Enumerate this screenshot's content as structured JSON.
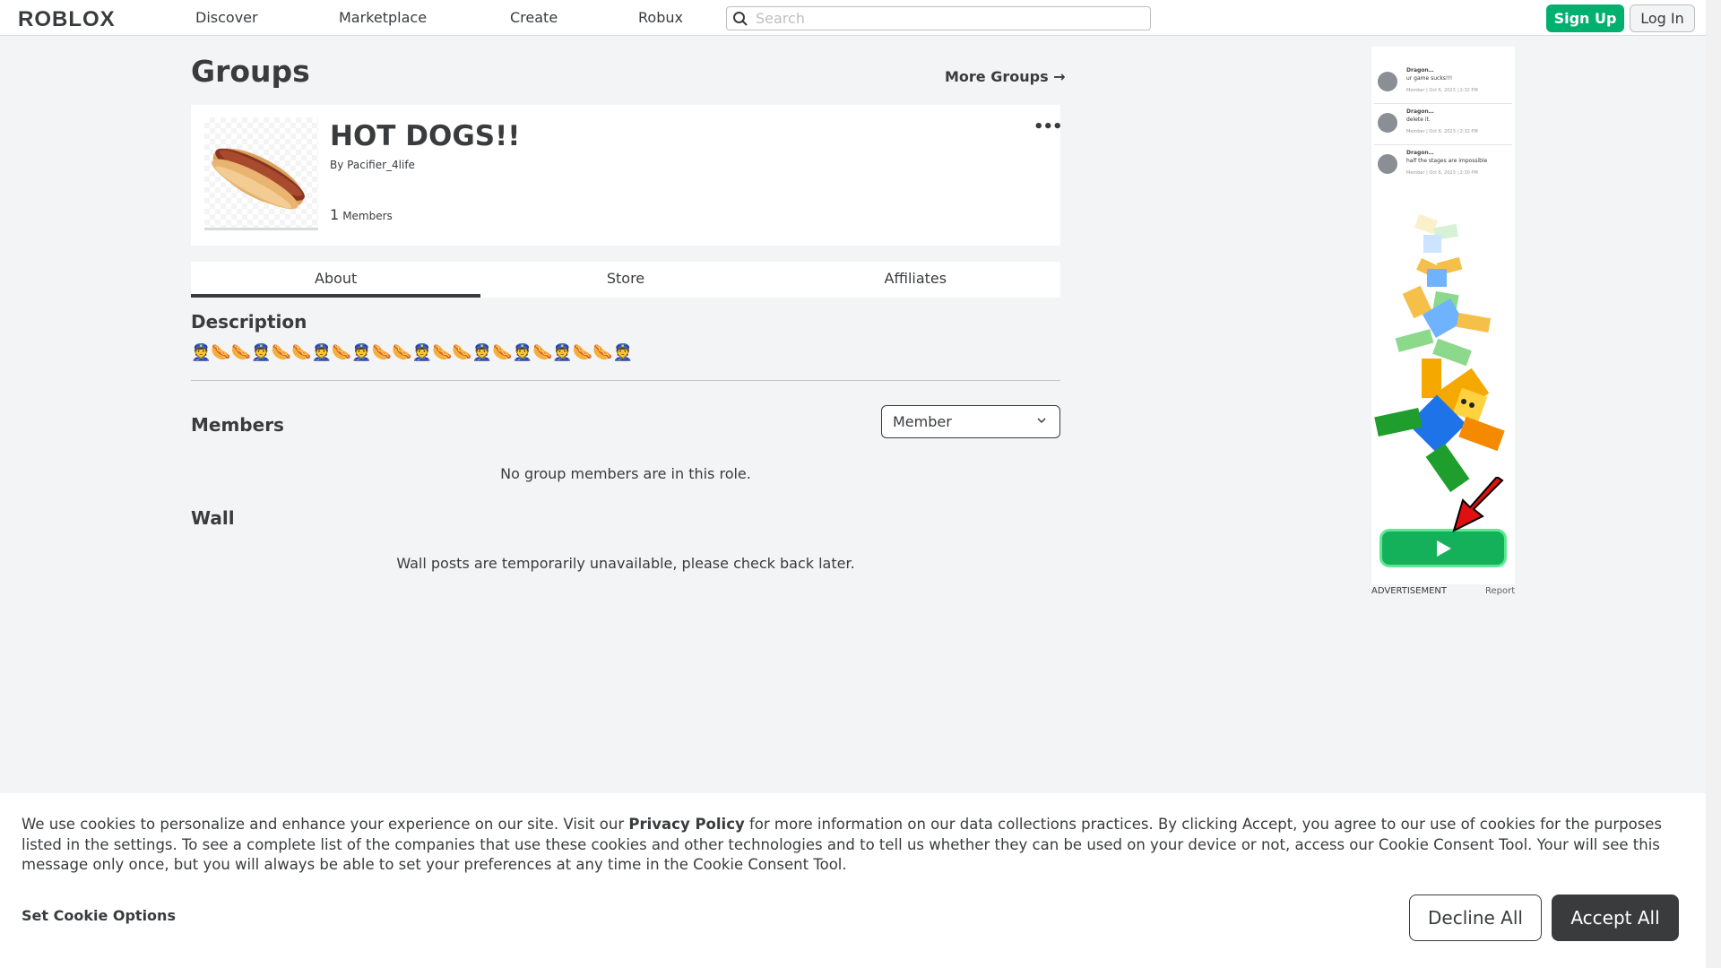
{
  "nav": {
    "logo": "ROBLOX",
    "items": [
      "Discover",
      "Marketplace",
      "Create",
      "Robux"
    ],
    "search_placeholder": "Search",
    "signup": "Sign Up",
    "login": "Log In"
  },
  "page": {
    "title": "Groups",
    "more_groups": "More Groups →"
  },
  "group": {
    "name": "HOT DOGS!!",
    "by_label": "By",
    "owner": "Pacifier_4life",
    "member_count": "1",
    "members_label": "Members",
    "menu_glyph": "•••"
  },
  "tabs": [
    "About",
    "Store",
    "Affiliates"
  ],
  "about": {
    "description_heading": "Description",
    "description_text": "👮🌭🌭👮🌭🌭👮🌭👮🌭🌭👮🌭🌭👮🌭👮🌭👮🌭🌭👮",
    "members_heading": "Members",
    "role_select": "Member",
    "no_members": "No group members are in this role.",
    "wall_heading": "Wall",
    "wall_message": "Wall posts are temporarily unavailable, please check back later."
  },
  "ad": {
    "posts": [
      {
        "name": "Dragon…",
        "text": "ur game sucks!!!",
        "time": "Member | Oct 6, 2023 | 2:32 PM"
      },
      {
        "name": "Dragon…",
        "text": "delete it.",
        "time": "Member | Oct 6, 2023 | 2:32 PM"
      },
      {
        "name": "Dragon…",
        "text": "half the stages are impossible",
        "time": "Member | Oct 6, 2023 | 2:30 PM"
      }
    ],
    "label": "ADVERTISEMENT",
    "report": "Report"
  },
  "cookie": {
    "text_before": "We use cookies to personalize and enhance your experience on our site. Visit our ",
    "privacy_link": "Privacy Policy",
    "text_after": " for more information on our data collections practices. By clicking Accept, you agree to our use of cookies for the purposes listed in the settings. To see a complete list of the companies that use these cookies and other technologies and to tell us whether they can be used on your device or not, access our Cookie Consent Tool. Your will see this message only once, but you will always be able to set your preferences at any time in the Cookie Consent Tool.",
    "set_options": "Set Cookie Options",
    "decline": "Decline All",
    "accept": "Accept All"
  },
  "colors": {
    "accent_green": "#00b06f",
    "text_dark": "#393b3d",
    "background": "#f2f4f5"
  }
}
